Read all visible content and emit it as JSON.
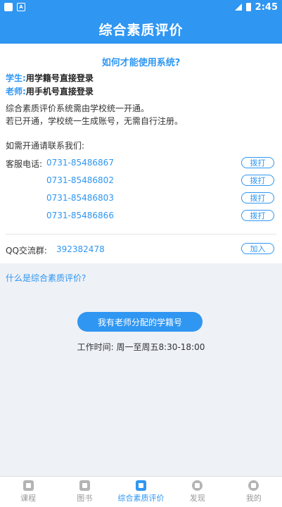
{
  "status_bar": {
    "time": "2:45",
    "notif_icon": "A"
  },
  "header": {
    "title": "综合素质评价"
  },
  "help": {
    "title": "如何才能使用系统?",
    "student_role": "学生:",
    "student_text": "用学籍号直接登录",
    "teacher_role": "老师:",
    "teacher_text": "用手机号直接登录",
    "line1": "综合素质评价系统需由学校统一开通。",
    "line2": "若已开通，学校统一生成账号，无需自行注册。",
    "contact_intro": "如需开通请联系我们:"
  },
  "contact": {
    "phone_label": "客服电话:",
    "call_label": "拨打",
    "phones": [
      "0731-85486867",
      "0731-85486802",
      "0731-85486803",
      "0731-85486866"
    ],
    "qq_label": "QQ交流群:",
    "qq_number": "392382478",
    "join_label": "加入"
  },
  "info": {
    "what_is": "什么是综合素质评价?",
    "teacher_id_button": "我有老师分配的学籍号",
    "work_time": "工作时间: 周一至周五8:30-18:00"
  },
  "tabs": [
    {
      "label": "课程",
      "icon": "course-icon",
      "active": false
    },
    {
      "label": "图书",
      "icon": "book-icon",
      "active": false
    },
    {
      "label": "综合素质评价",
      "icon": "evaluation-icon",
      "active": true
    },
    {
      "label": "发现",
      "icon": "discover-icon",
      "active": false
    },
    {
      "label": "我的",
      "icon": "profile-icon",
      "active": false
    }
  ],
  "colors": {
    "accent": "#2f96f2",
    "background_gray": "#eef1f6"
  }
}
